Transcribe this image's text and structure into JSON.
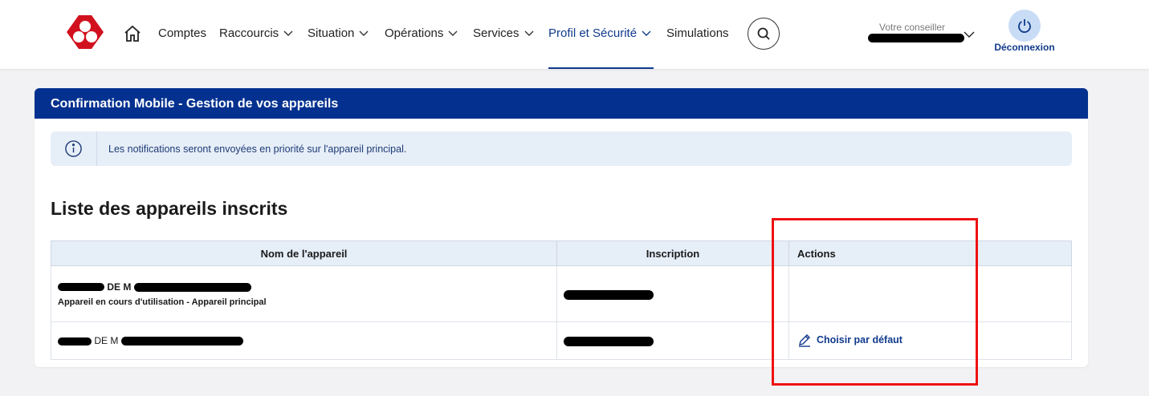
{
  "nav": {
    "items": [
      {
        "label": "Comptes"
      },
      {
        "label": "Raccourcis"
      },
      {
        "label": "Situation"
      },
      {
        "label": "Opérations"
      },
      {
        "label": "Services"
      },
      {
        "label": "Profil et Sécurité"
      },
      {
        "label": "Simulations"
      }
    ],
    "active": "Profil et Sécurité"
  },
  "advisor": {
    "label": "Votre conseiller"
  },
  "logout": {
    "label": "Déconnexion"
  },
  "colors": {
    "brand": "#04318f",
    "accent": "#103a8c",
    "logo": "#d1121e",
    "highlight": "#ee1111"
  },
  "card": {
    "title": "Confirmation Mobile - Gestion de vos appareils",
    "info": "Les notifications seront envoyées en priorité sur l'appareil principal.",
    "section_title": "Liste des appareils inscrits",
    "table": {
      "headers": [
        "Nom de l'appareil",
        "Inscription",
        "Actions"
      ],
      "rows": [
        {
          "name_mid": "DE M",
          "subtitle": "Appareil en cours d'utilisation - Appareil principal",
          "action": ""
        },
        {
          "name_mid": "DE M",
          "subtitle": "",
          "action": "Choisir par défaut"
        }
      ]
    }
  }
}
